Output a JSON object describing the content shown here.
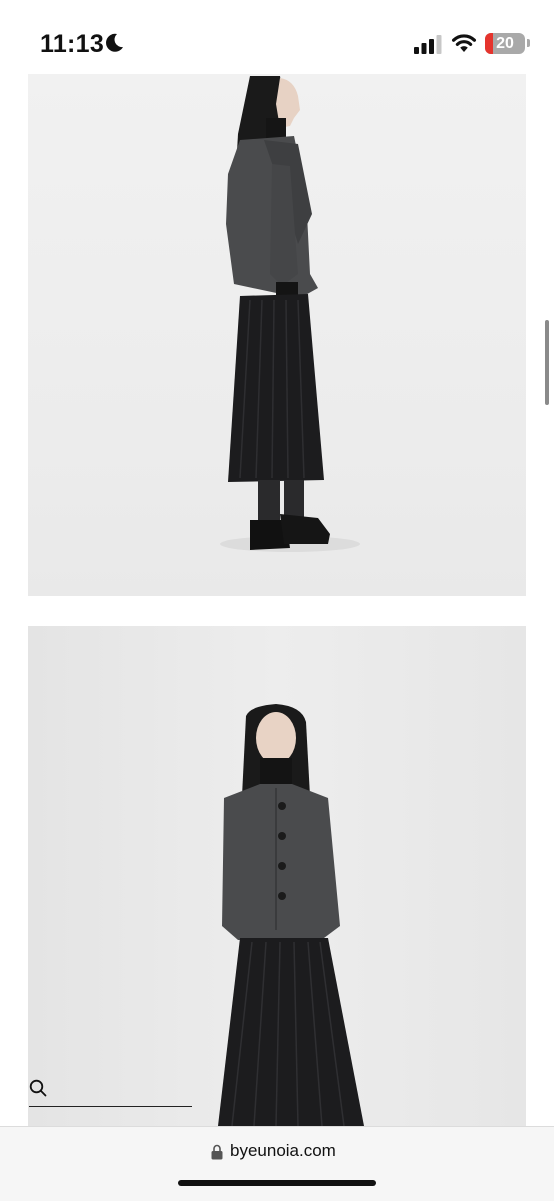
{
  "status_bar": {
    "time": "11:13",
    "focus_icon": "moon-icon",
    "signal_icon": "cellular-signal-icon",
    "wifi_icon": "wifi-icon",
    "battery": {
      "level": "20",
      "level_fraction": 0.2,
      "fill_color": "#e5342d"
    }
  },
  "content": {
    "photos": [
      {
        "name": "product-photo-side-view",
        "subject": "model-side-profile"
      },
      {
        "name": "product-photo-front-view",
        "subject": "model-front"
      }
    ],
    "search": {
      "icon": "search-icon"
    }
  },
  "browser": {
    "url": "byeunoia.com",
    "lock_icon": "lock-icon"
  },
  "colors": {
    "jacket": "#4a4b4d",
    "skirt": "#1c1c1e",
    "background": "#ffffff",
    "battery_low": "#e5342d"
  }
}
